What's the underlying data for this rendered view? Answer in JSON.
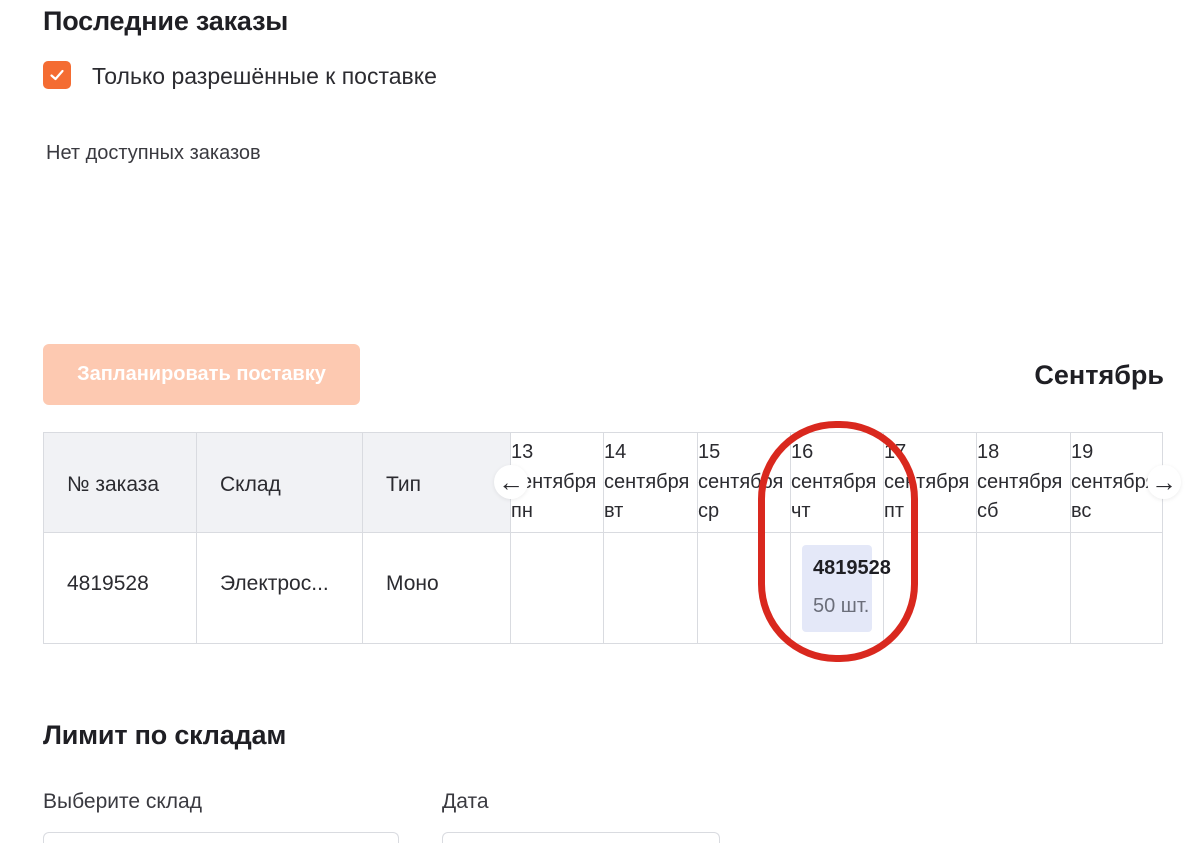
{
  "recent_orders": {
    "title": "Последние заказы",
    "only_approved_label": "Только разрешённые к поставке",
    "only_approved_checked": true,
    "empty_text": "Нет доступных заказов"
  },
  "schedule": {
    "plan_button_label": "Запланировать поставку",
    "month": "Сентябрь",
    "columns": {
      "order_no": "№ заказа",
      "warehouse": "Склад",
      "type": "Тип"
    },
    "days": [
      {
        "day": "13",
        "month": "сентября",
        "weekday": "пн"
      },
      {
        "day": "14",
        "month": "сентября",
        "weekday": "вт"
      },
      {
        "day": "15",
        "month": "сентября",
        "weekday": "ср"
      },
      {
        "day": "16",
        "month": "сентября",
        "weekday": "чт"
      },
      {
        "day": "17",
        "month": "сентября",
        "weekday": "пт"
      },
      {
        "day": "18",
        "month": "сентября",
        "weekday": "сб"
      },
      {
        "day": "19",
        "month": "сентября",
        "weekday": "вс"
      }
    ],
    "row": {
      "order_no": "4819528",
      "warehouse": "Электрос...",
      "type": "Моно"
    },
    "card": {
      "order_no": "4819528",
      "quantity": "50 шт."
    },
    "nav_prev_icon": "arrow-left-icon",
    "nav_next_icon": "arrow-right-icon"
  },
  "warehouse_limit": {
    "title": "Лимит по складам",
    "warehouse_label": "Выберите склад",
    "date_label": "Дата"
  },
  "colors": {
    "accent": "#f46c32",
    "accent_disabled": "#fdc9b1",
    "card_bg": "#e4e8f8",
    "highlight": "#d9281e"
  }
}
